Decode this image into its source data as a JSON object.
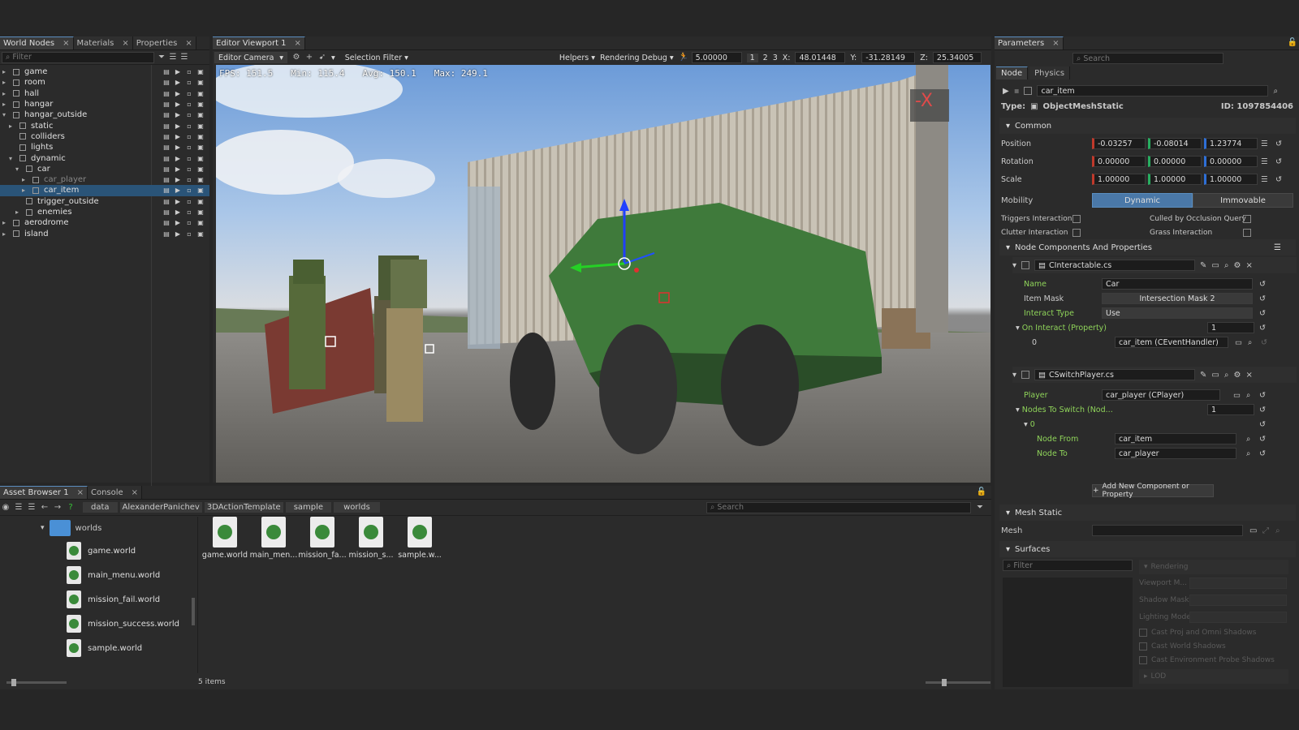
{
  "left_panel": {
    "tabs": [
      {
        "label": "World Nodes"
      },
      {
        "label": "Materials"
      },
      {
        "label": "Properties"
      }
    ],
    "filter_placeholder": "Filter",
    "nodes": [
      {
        "label": "game",
        "depth": 0,
        "expander": "▸"
      },
      {
        "label": "room",
        "depth": 0,
        "expander": "▸"
      },
      {
        "label": "hall",
        "depth": 0,
        "expander": "▸"
      },
      {
        "label": "hangar",
        "depth": 0,
        "expander": "▸"
      },
      {
        "label": "hangar_outside",
        "depth": 0,
        "expander": "▾"
      },
      {
        "label": "static",
        "depth": 1,
        "expander": "▸"
      },
      {
        "label": "colliders",
        "depth": 1,
        "expander": ""
      },
      {
        "label": "lights",
        "depth": 1,
        "expander": ""
      },
      {
        "label": "dynamic",
        "depth": 1,
        "expander": "▾"
      },
      {
        "label": "car",
        "depth": 2,
        "expander": "▾"
      },
      {
        "label": "car_player",
        "depth": 3,
        "expander": "▸"
      },
      {
        "label": "car_item",
        "depth": 3,
        "expander": "▸"
      },
      {
        "label": "trigger_outside",
        "depth": 2,
        "expander": ""
      },
      {
        "label": "enemies",
        "depth": 2,
        "expander": "▸"
      },
      {
        "label": "aerodrome",
        "depth": 0,
        "expander": "▸"
      },
      {
        "label": "island",
        "depth": 0,
        "expander": "▸"
      }
    ]
  },
  "viewport": {
    "tab": "Editor Viewport 1",
    "camera": "Editor Camera",
    "selection_filter": "Selection Filter",
    "helpers": "Helpers",
    "rendering_debug": "Rendering Debug",
    "speed": "5.00000",
    "nums": [
      "1",
      "2",
      "3"
    ],
    "x_label": "X:",
    "x": "48.01448",
    "y_label": "Y:",
    "y": "-31.28149",
    "z_label": "Z:",
    "z": "25.34005",
    "fps": "FPS: 151.5",
    "min": "Min: 115.4",
    "avg": "Avg: 150.1",
    "max": "Max: 249.1",
    "gizmo": "-X"
  },
  "asset_browser": {
    "tabs": [
      {
        "label": "Asset Browser 1"
      },
      {
        "label": "Console"
      }
    ],
    "crumbs": [
      "data",
      "AlexanderPanichev",
      "3DActionTemplate",
      "sample",
      "worlds"
    ],
    "search_placeholder": "Search",
    "folder": "worlds",
    "tree_files": [
      "game.world",
      "main_menu.world",
      "mission_fail.world",
      "mission_success.world",
      "sample.world"
    ],
    "files": [
      "game.world",
      "main_men...",
      "mission_fa...",
      "mission_s...",
      "sample.w..."
    ],
    "count": "5 items"
  },
  "params": {
    "tab": "Parameters",
    "search_placeholder": "Search",
    "subtabs": [
      {
        "label": "Node"
      },
      {
        "label": "Physics"
      }
    ],
    "node_name": "car_item",
    "type_label": "Type:",
    "type_value": "ObjectMeshStatic",
    "id": "ID: 1097854406",
    "common": "Common",
    "position_label": "Position",
    "position": [
      "-0.03257",
      "-0.08014",
      "1.23774"
    ],
    "rotation_label": "Rotation",
    "rotation": [
      "0.00000",
      "0.00000",
      "0.00000"
    ],
    "scale_label": "Scale",
    "scale": [
      "1.00000",
      "1.00000",
      "1.00000"
    ],
    "mobility_label": "Mobility",
    "mobility_dynamic": "Dynamic",
    "mobility_immovable": "Immovable",
    "triggers_interaction": "Triggers Interaction",
    "culled_by_occlusion": "Culled by Occlusion Query",
    "clutter_interaction": "Clutter Interaction",
    "grass_interaction": "Grass Interaction",
    "components_title": "Node Components And Properties",
    "comp1": {
      "file": "CInteractable.cs",
      "name_label": "Name",
      "name_value": "Car",
      "item_mask_label": "Item Mask",
      "item_mask_value": "Intersection Mask 2",
      "interact_type_label": "Interact Type",
      "interact_type_value": "Use",
      "on_interact_label": "On Interact (Property)",
      "on_interact_count": "1",
      "row_index": "0",
      "row_value": "car_item (CEventHandler)"
    },
    "comp2": {
      "file": "CSwitchPlayer.cs",
      "player_label": "Player",
      "player_value": "car_player (CPlayer)",
      "nodes_to_switch_label": "Nodes To Switch (Nod...",
      "nodes_to_switch_count": "1",
      "item_index": "0",
      "node_from_label": "Node From",
      "node_from_value": "car_item",
      "node_to_label": "Node To",
      "node_to_value": "car_player"
    },
    "add_component": "Add New Component or Property",
    "mesh_static": "Mesh Static",
    "mesh_label": "Mesh",
    "surfaces": "Surfaces",
    "surfaces_filter": "Filter",
    "rendering": "Rendering",
    "viewport_mask": "Viewport M...",
    "shadow_mask": "Shadow Mask",
    "lighting_mode": "Lighting Mode",
    "cast_proj": "Cast Proj and Omni Shadows",
    "cast_world": "Cast World Shadows",
    "cast_env": "Cast Environment Probe Shadows",
    "lod": "LOD"
  },
  "colors": {
    "accent": "#5a8ec0",
    "selection": "#2a5478",
    "green_label": "#8fd45a",
    "x_red": "#e04a4a",
    "y_green": "#37c637",
    "z_blue": "#3a5fe0",
    "z_teal": "#2ab0a0"
  }
}
